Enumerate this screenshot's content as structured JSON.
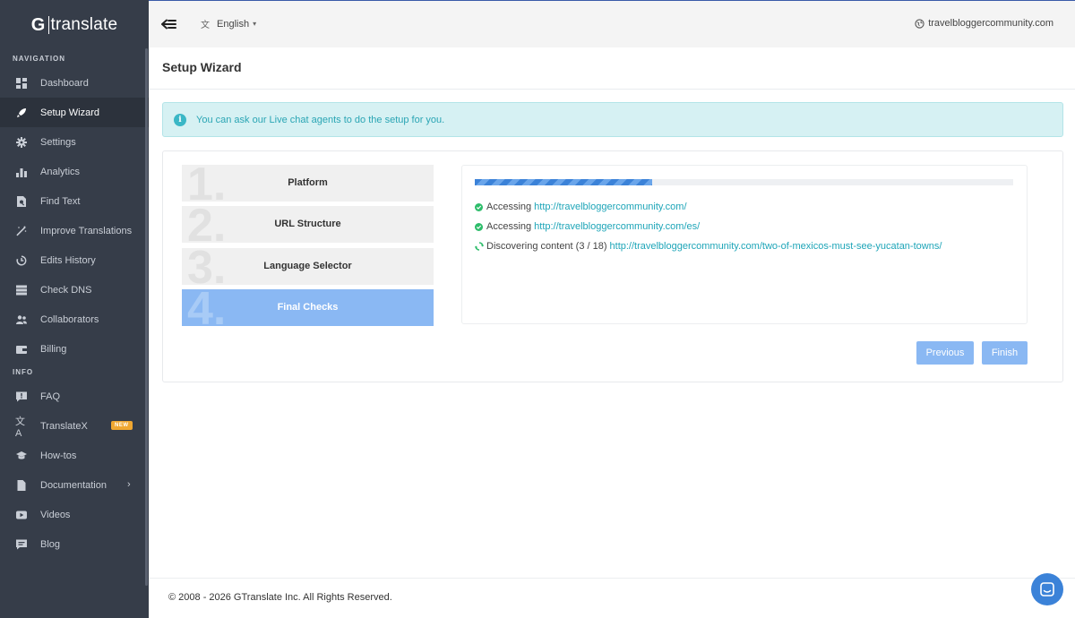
{
  "brand": {
    "logo_g": "G",
    "logo_rest": "translate"
  },
  "sidebar": {
    "nav_label": "NAVIGATION",
    "nav_items": [
      {
        "label": "Dashboard",
        "icon": "dashboard-icon"
      },
      {
        "label": "Setup Wizard",
        "icon": "rocket-icon",
        "active": true
      },
      {
        "label": "Settings",
        "icon": "gear-icon"
      },
      {
        "label": "Analytics",
        "icon": "bar-chart-icon"
      },
      {
        "label": "Find Text",
        "icon": "search-doc-icon"
      },
      {
        "label": "Improve Translations",
        "icon": "magic-wand-icon"
      },
      {
        "label": "Edits History",
        "icon": "history-icon"
      },
      {
        "label": "Check DNS",
        "icon": "server-icon"
      },
      {
        "label": "Collaborators",
        "icon": "users-icon"
      },
      {
        "label": "Billing",
        "icon": "wallet-icon"
      }
    ],
    "info_label": "INFO",
    "info_items": [
      {
        "label": "FAQ",
        "icon": "comment-question-icon"
      },
      {
        "label": "TranslateX",
        "icon": "translate-icon",
        "badge": "NEW"
      },
      {
        "label": "How-tos",
        "icon": "graduation-cap-icon"
      },
      {
        "label": "Documentation",
        "icon": "document-icon",
        "chevron": "›"
      },
      {
        "label": "Videos",
        "icon": "play-icon"
      },
      {
        "label": "Blog",
        "icon": "chat-lines-icon"
      }
    ]
  },
  "topbar": {
    "language": "English",
    "site": "travelbloggercommunity.com"
  },
  "page": {
    "title": "Setup Wizard"
  },
  "alert": {
    "text": "You can ask our Live chat agents to do the setup for you."
  },
  "wizard": {
    "steps": [
      {
        "num": "1.",
        "label": "Platform"
      },
      {
        "num": "2.",
        "label": "URL Structure"
      },
      {
        "num": "3.",
        "label": "Language Selector"
      },
      {
        "num": "4.",
        "label": "Final Checks",
        "active": true
      }
    ],
    "progress": 0.33,
    "log": [
      {
        "status": "done",
        "text": "Accessing",
        "link": "http://travelbloggercommunity.com/"
      },
      {
        "status": "done",
        "text": "Accessing",
        "link": "http://travelbloggercommunity.com/es/"
      },
      {
        "status": "loading",
        "text": "Discovering content (3 / 18)",
        "link": "http://travelbloggercommunity.com/two-of-mexicos-must-see-yucatan-towns/"
      }
    ],
    "prev_label": "Previous",
    "finish_label": "Finish"
  },
  "footer": {
    "text": "© 2008 - 2026 GTranslate Inc. All Rights Reserved."
  },
  "colors": {
    "sidebar_bg": "#363d49",
    "accent_blue": "#3b82d8",
    "button_blue": "#8ab8f3",
    "link_teal": "#1ea5b8",
    "success_green": "#2ebd6b"
  }
}
